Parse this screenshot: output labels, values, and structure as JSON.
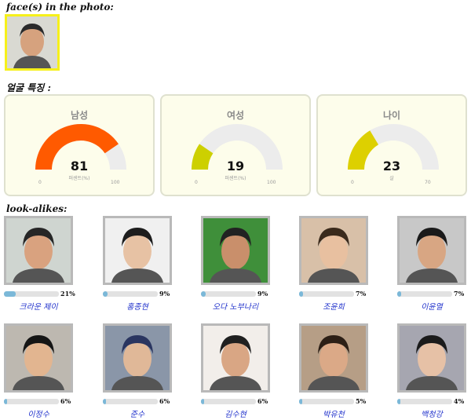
{
  "headings": {
    "faces": "face(s) in the photo:",
    "features": "얼굴 특징 :",
    "lookalikes": "look-alikes:"
  },
  "gauges": [
    {
      "title": "남성",
      "value": "81",
      "unit": "퍼센트(%)",
      "min": "0",
      "max": "100",
      "fraction": 0.81,
      "color": "#ff5a00"
    },
    {
      "title": "여성",
      "value": "19",
      "unit": "퍼센트(%)",
      "min": "0",
      "max": "100",
      "fraction": 0.19,
      "color": "#cdd000"
    },
    {
      "title": "나이",
      "value": "23",
      "unit": "살",
      "min": "0",
      "max": "70",
      "fraction": 0.3286,
      "color": "#ddd000"
    }
  ],
  "lookalikes": [
    {
      "name": "크라운 제이",
      "pct": "21%",
      "fraction": 0.21
    },
    {
      "name": "홍종현",
      "pct": "9%",
      "fraction": 0.09
    },
    {
      "name": "오다 노부나리",
      "pct": "9%",
      "fraction": 0.09
    },
    {
      "name": "조윤희",
      "pct": "7%",
      "fraction": 0.07
    },
    {
      "name": "이윤열",
      "pct": "7%",
      "fraction": 0.07
    },
    {
      "name": "이정수",
      "pct": "6%",
      "fraction": 0.06
    },
    {
      "name": "준수",
      "pct": "6%",
      "fraction": 0.06
    },
    {
      "name": "김수현",
      "pct": "6%",
      "fraction": 0.06
    },
    {
      "name": "박유천",
      "pct": "5%",
      "fraction": 0.05
    },
    {
      "name": "백청강",
      "pct": "4%",
      "fraction": 0.04
    }
  ],
  "colors": {
    "bar_fill": "#7bb8d8",
    "bar_track": "#e2e2e2",
    "name_link": "#2233cc",
    "gauge_track": "#ececec"
  }
}
